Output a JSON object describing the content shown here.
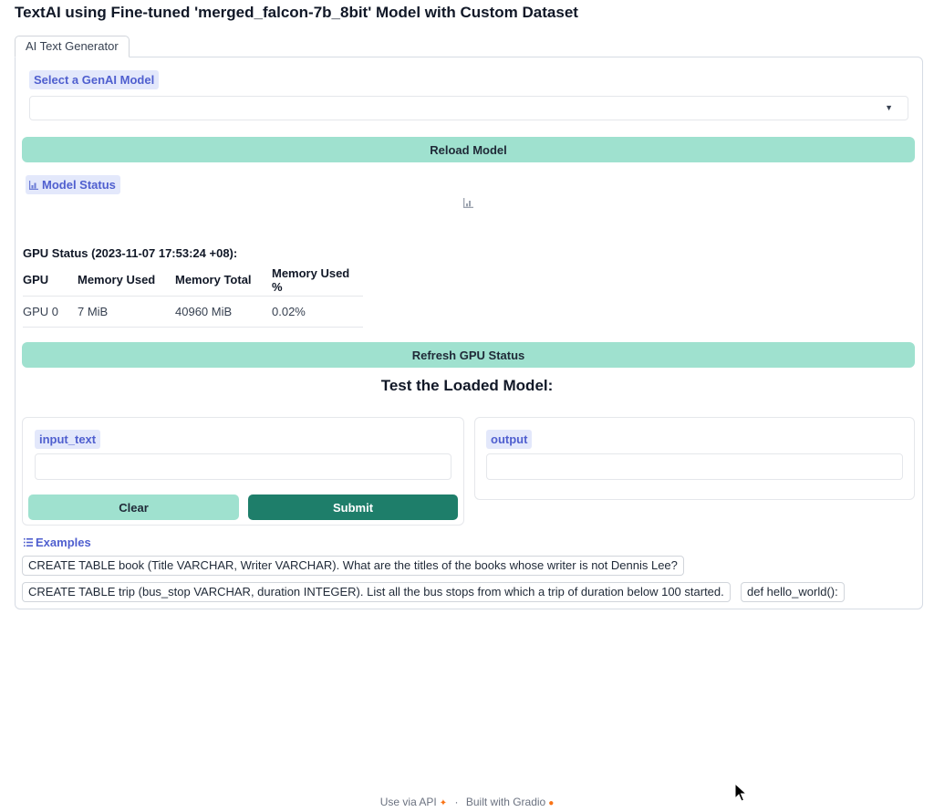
{
  "page": {
    "title": "TextAI using Fine-tuned 'merged_falcon-7b_8bit' Model with Custom Dataset"
  },
  "tabs": [
    {
      "label": "AI Text Generator"
    }
  ],
  "model_select": {
    "label": "Select a GenAI Model",
    "value": "",
    "arrow_icon": "caret-down-icon"
  },
  "reload_button": {
    "label": "Reload Model"
  },
  "model_status": {
    "label": "Model Status",
    "icon": "bar-chart-icon"
  },
  "gpu_status": {
    "heading": "GPU Status (2023-11-07 17:53:24 +08):",
    "columns": [
      "GPU",
      "Memory Used",
      "Memory Total",
      "Memory Used %"
    ],
    "rows": [
      [
        "GPU 0",
        "7 MiB",
        "40960 MiB",
        "0.02%"
      ]
    ]
  },
  "refresh_button": {
    "label": "Refresh GPU Status"
  },
  "test_section": {
    "title": "Test the Loaded Model:",
    "input": {
      "label": "input_text",
      "value": ""
    },
    "output": {
      "label": "output",
      "value": ""
    },
    "clear_label": "Clear",
    "submit_label": "Submit"
  },
  "examples": {
    "label": "Examples",
    "items": [
      "CREATE TABLE book (Title VARCHAR, Writer VARCHAR). What are the titles of the books whose writer is not Dennis Lee?",
      "CREATE TABLE trip (bus_stop VARCHAR, duration INTEGER). List all the bus stops from which a trip of duration below 100 started.",
      "def hello_world():"
    ]
  },
  "footer": {
    "api_link": "Use via API",
    "separator": "·",
    "built_with": "Built with Gradio"
  },
  "colors": {
    "accent_teal": "#9fe1cf",
    "submit_green": "#1e7e6a",
    "label_blue": "#4f5fcf",
    "label_bg": "#e3e8fb"
  }
}
